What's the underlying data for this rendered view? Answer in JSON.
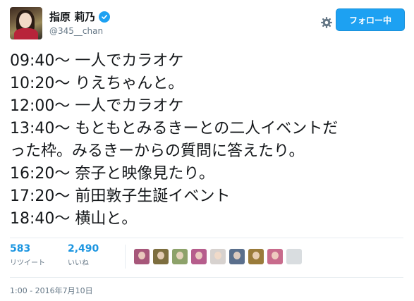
{
  "user": {
    "display_name": "指原 莉乃",
    "handle": "@345__chan"
  },
  "header": {
    "follow_label": "フォロー中"
  },
  "tweet": {
    "lines": [
      "09:40〜 一人でカラオケ",
      "10:20〜 りえちゃんと。",
      "12:00〜 一人でカラオケ",
      "13:40〜 もともとみるきーとの二人イベントだ",
      "った枠。みるきーからの質問に答えたり。",
      "16:20〜 奈子と映像見たり。",
      "17:20〜 前田敦子生誕イベント",
      "18:40〜 横山と。"
    ],
    "timestamp": "1:00 - 2016年7月10日"
  },
  "stats": {
    "retweets": {
      "count": "583",
      "label": "リツイート"
    },
    "likes": {
      "count": "2,490",
      "label": "いいね"
    }
  },
  "likers": [
    {
      "name": "liker-avatar-1",
      "color": "#a7577a"
    },
    {
      "name": "liker-avatar-2",
      "color": "#7d6e3f"
    },
    {
      "name": "liker-avatar-3",
      "color": "#8da26a"
    },
    {
      "name": "liker-avatar-4",
      "color": "#b65d8c"
    },
    {
      "name": "liker-avatar-5",
      "color": "#d7d2cf"
    },
    {
      "name": "liker-avatar-6",
      "color": "#5a6f8c"
    },
    {
      "name": "liker-avatar-7",
      "color": "#9a7b3a"
    },
    {
      "name": "liker-avatar-8",
      "color": "#c86b8c"
    },
    {
      "name": "liker-avatar-9",
      "color": "#d9dde0",
      "blank": true
    }
  ],
  "colors": {
    "accent": "#1da1f2",
    "link": "#1b95e0",
    "muted": "#657786",
    "text": "#14171a"
  },
  "icons": {
    "verified": "verified-badge-icon",
    "settings": "gear-icon"
  }
}
